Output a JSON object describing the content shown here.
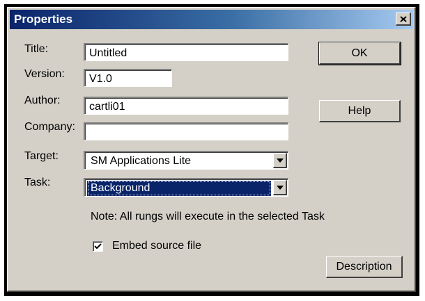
{
  "window": {
    "title": "Properties"
  },
  "fields": {
    "title": {
      "label": "Title:",
      "value": "Untitled"
    },
    "version": {
      "label": "Version:",
      "value": "V1.0"
    },
    "author": {
      "label": "Author:",
      "value": "cartli01"
    },
    "company": {
      "label": "Company:",
      "value": ""
    },
    "target": {
      "label": "Target:",
      "value": "SM Applications Lite"
    },
    "task": {
      "label": "Task:",
      "value": "Background"
    }
  },
  "note": "Note: All rungs will execute in the selected Task",
  "embed_source": {
    "label": "Embed source file",
    "checked": true
  },
  "buttons": {
    "ok": "OK",
    "help": "Help",
    "description": "Description"
  },
  "icons": {
    "close": "close-icon",
    "dropdown": "chevron-down-icon",
    "check": "checkmark-icon"
  }
}
